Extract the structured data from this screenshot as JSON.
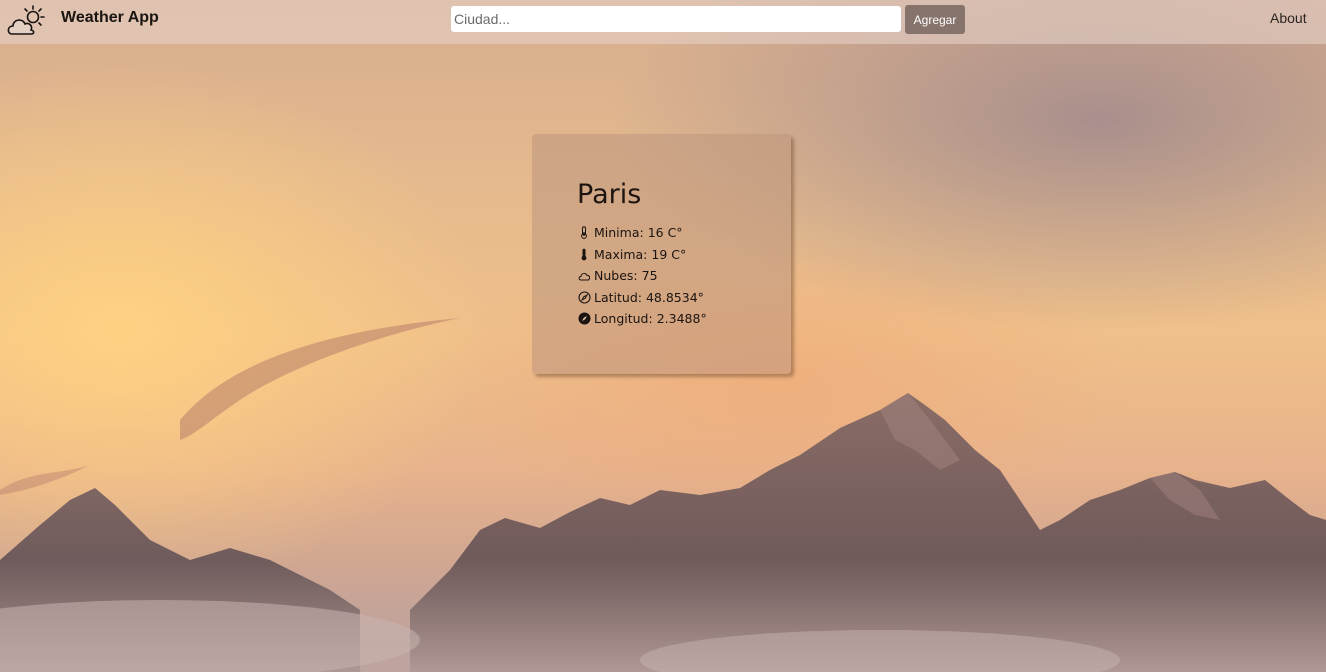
{
  "app": {
    "title": "Weather App",
    "logo_icon": "cloud-sun-icon"
  },
  "search": {
    "placeholder": "Ciudad...",
    "value": "",
    "button_label": "Agregar",
    "button_color": "#86736b"
  },
  "nav": {
    "about_label": "About"
  },
  "card": {
    "city": "Paris",
    "stats": [
      {
        "icon": "thermometer-low-icon",
        "label": "Minima:",
        "value": "16 C°"
      },
      {
        "icon": "thermometer-high-icon",
        "label": "Maxima:",
        "value": "19 C°"
      },
      {
        "icon": "cloud-icon",
        "label": "Nubes:",
        "value": "75"
      },
      {
        "icon": "compass-icon",
        "label": "Latitud:",
        "value": "48.8534°"
      },
      {
        "icon": "compass-filled-icon",
        "label": "Longitud:",
        "value": "2.3488°"
      }
    ]
  }
}
